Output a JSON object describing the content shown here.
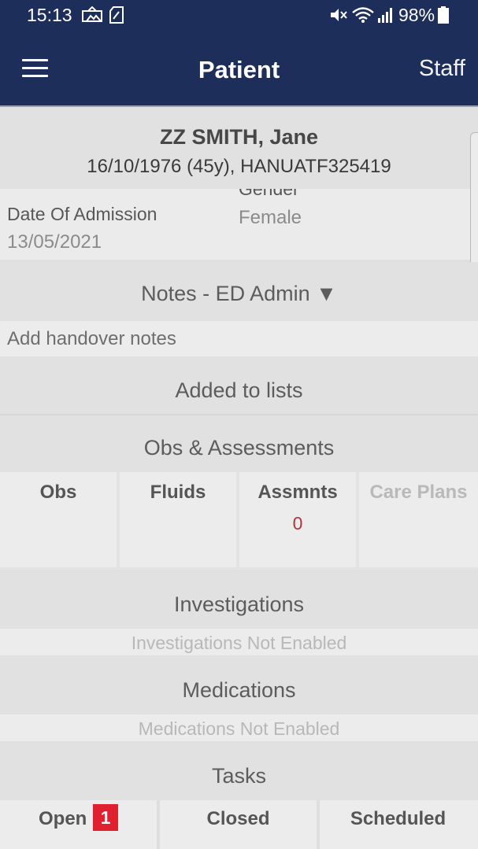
{
  "status_bar": {
    "time": "15:13",
    "battery": "98%"
  },
  "app_bar": {
    "title": "Patient",
    "staff_label": "Staff"
  },
  "patient": {
    "name": "ZZ SMITH, Jane",
    "details": "16/10/1976 (45y), HANUATF325419",
    "admission_label": "Date Of Admission",
    "admission_value": "13/05/2021",
    "gender_label": "Gender",
    "gender_value": "Female"
  },
  "notes": {
    "header": "Notes - ED Admin ▼",
    "placeholder": "Add handover notes"
  },
  "lists": {
    "header": "Added to lists"
  },
  "obs": {
    "header": "Obs & Assessments",
    "tiles": [
      {
        "label": "Obs"
      },
      {
        "label": "Fluids"
      },
      {
        "label": "Assmnts",
        "count": "0"
      },
      {
        "label": "Care Plans"
      }
    ]
  },
  "investigations": {
    "header": "Investigations",
    "status": "Investigations Not Enabled"
  },
  "medications": {
    "header": "Medications",
    "status": "Medications Not Enabled"
  },
  "tasks": {
    "header": "Tasks",
    "tabs": [
      {
        "label": "Open",
        "badge": "1"
      },
      {
        "label": "Closed"
      },
      {
        "label": "Scheduled"
      }
    ]
  },
  "colors": {
    "app_bar": "#1e2e5a",
    "badge": "#e0202e",
    "count": "#b5323f"
  }
}
